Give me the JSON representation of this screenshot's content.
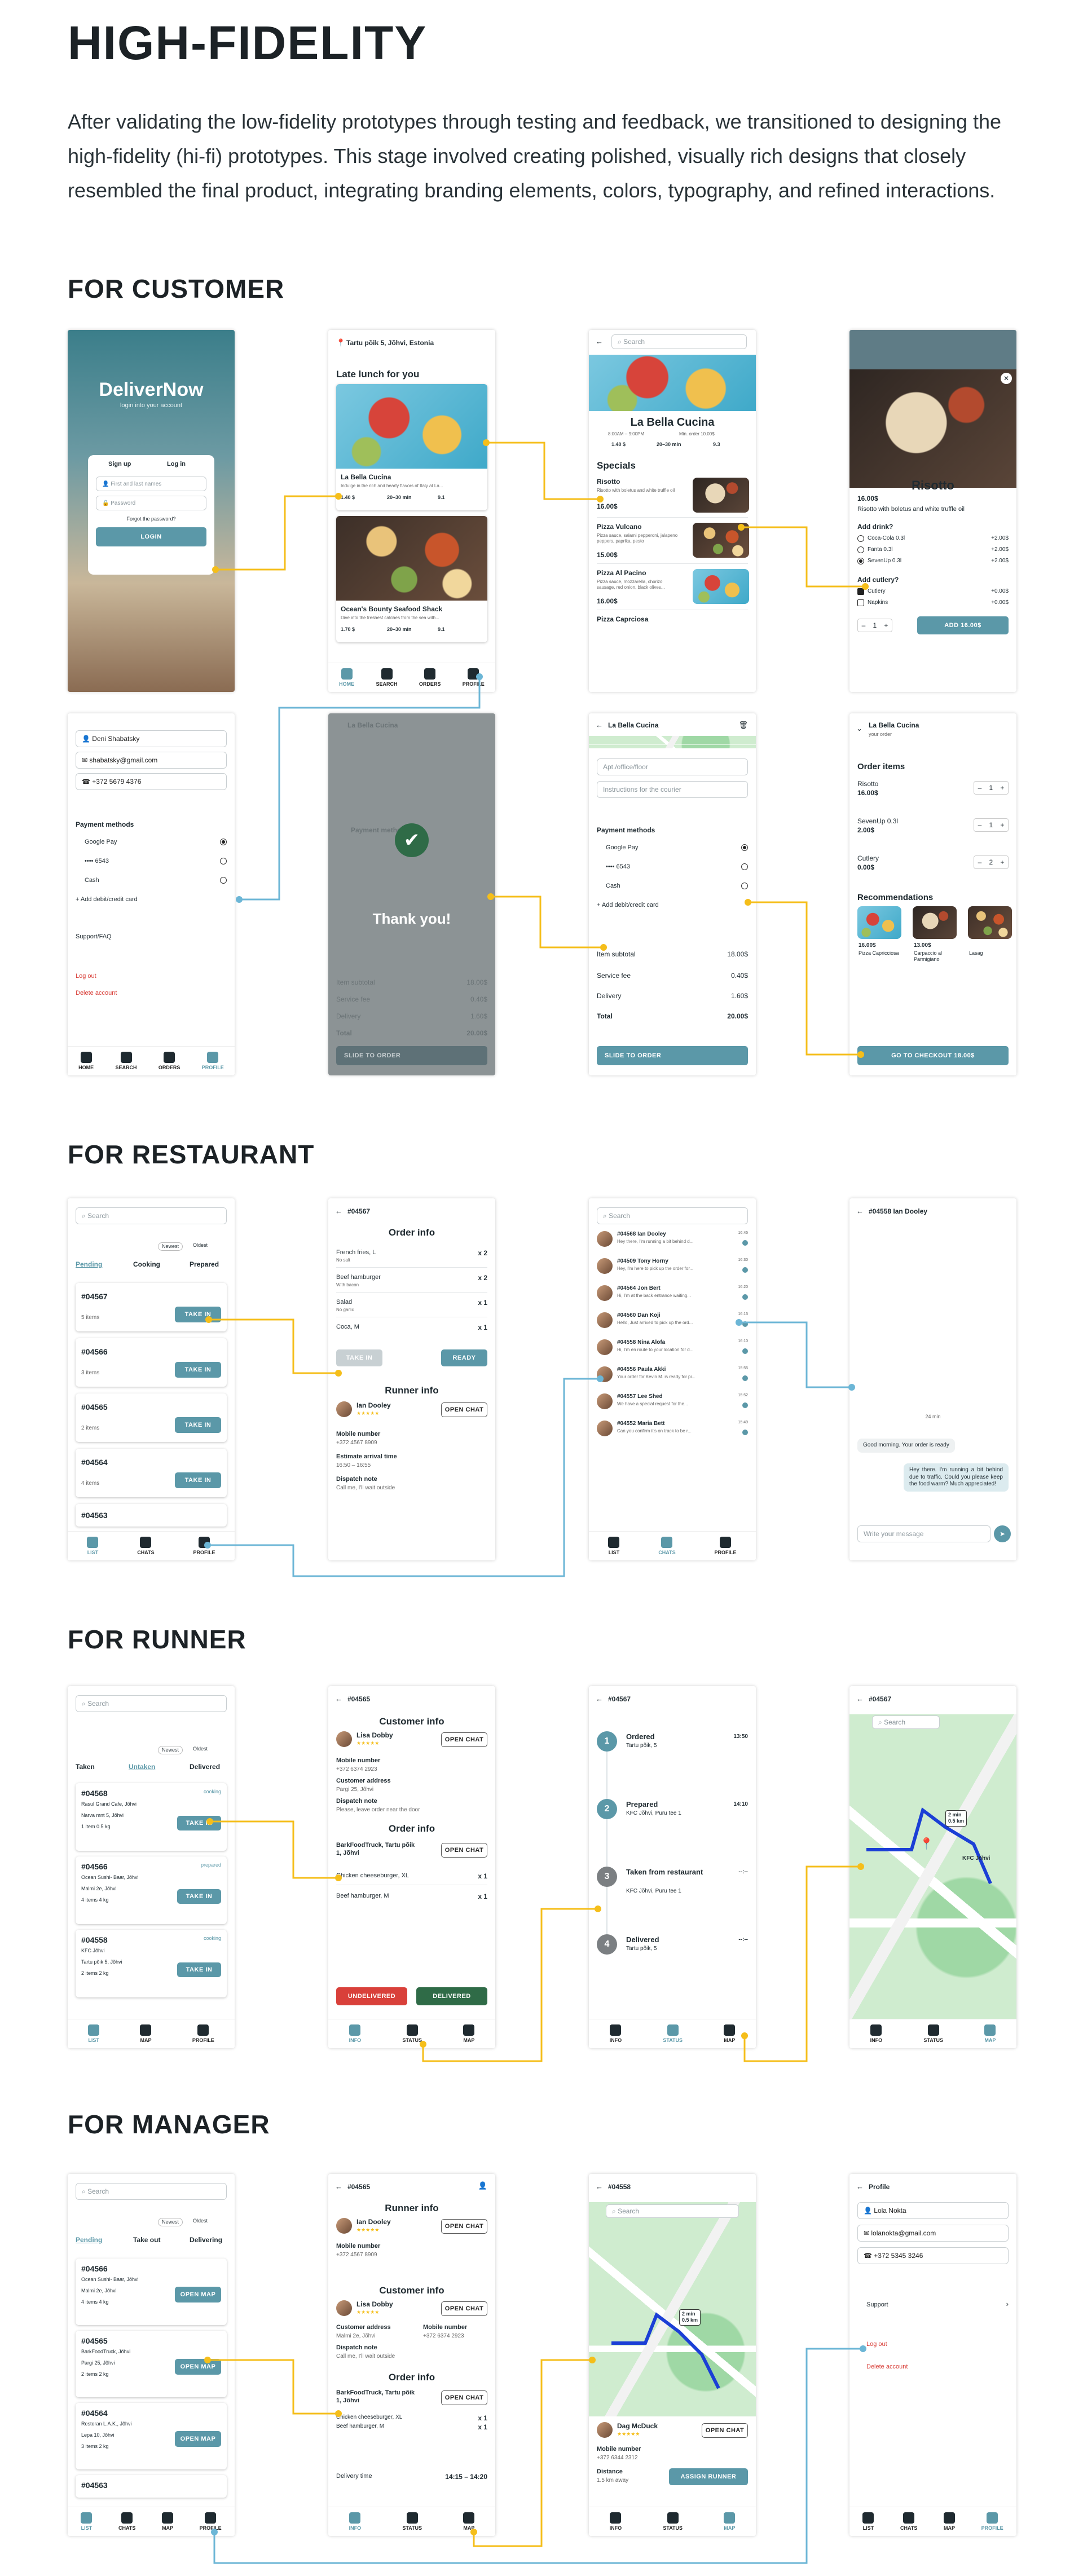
{
  "title": "HIGH-FIDELITY",
  "intro": "After validating the low-fidelity prototypes through testing and feedback, we transitioned to designing the high-fidelity (hi-fi) prototypes. This stage involved creating polished, visually rich designs that closely resembled the final product, integrating branding elements, colors, typography, and refined interactions.",
  "sections": {
    "customer": "FOR CUSTOMER",
    "restaurant": "FOR RESTAURANT",
    "runner": "FOR RUNNER",
    "manager": "FOR MANAGER"
  },
  "colors": {
    "accent": "#5b98a8",
    "connector": "#f5be1a",
    "connector_blue": "#6cb6d6",
    "danger": "#d9403a",
    "success": "#2f6b47"
  },
  "login": {
    "brand": "DeliverNow",
    "subtitle": "login into your account",
    "tab_signup": "Sign up",
    "tab_login": "Log in",
    "name_ph": "First and last names",
    "password_ph": "Password",
    "forgot": "Forgot the password?",
    "button": "LOGIN"
  },
  "home": {
    "address": "Tartu põik 5, Jõhvi, Estonia",
    "heading": "Late lunch for you",
    "r1": {
      "name": "La Bella Cucina",
      "desc": "Indulge in the rich and hearty flavors of Italy at La...",
      "price": "1.40 $",
      "time": "20–30 min",
      "rating": "9.1"
    },
    "r2": {
      "name": "Ocean's Bounty Seafood Shack",
      "desc": "Dive into the freshest catches from the sea with...",
      "price": "1.70 $",
      "time": "20–30 min",
      "rating": "9.1"
    }
  },
  "tabs": {
    "home": "HOME",
    "search": "SEARCH",
    "orders": "ORDERS",
    "profile": "PROFILE",
    "list": "LIST",
    "chats": "CHATS",
    "map": "MAP",
    "info": "INFO",
    "status": "STATUS"
  },
  "search_ph": "Search",
  "restaurant_page": {
    "name": "La Bella Cucina",
    "hours": "8:00AM – 9:00PM",
    "min_order": "Min. order 10.00$",
    "price": "1.40 $",
    "time": "20–30 min",
    "rating": "9.3",
    "specials": "Specials",
    "items": [
      {
        "name": "Risotto",
        "desc": "Risotto with boletus and white truffle oil",
        "price": "16.00$"
      },
      {
        "name": "Pizza Vulcano",
        "desc": "Pizza sauce, salami pepperoni, jalapeno peppers, paprika, pesto",
        "price": "15.00$"
      },
      {
        "name": "Pizza Al Pacino",
        "desc": "Pizza sauce, mozzarella, chorizo sausage, red onion, black olives...",
        "price": "16.00$"
      },
      {
        "name": "Pizza Caprciosa",
        "desc": "",
        "price": ""
      }
    ]
  },
  "dish": {
    "name": "Risotto",
    "price": "16.00$",
    "desc": "Risotto with boletus and white truffle oil",
    "drink_title": "Add drink?",
    "drinks": [
      {
        "name": "Coca-Cola 0.3l",
        "price": "+2.00$"
      },
      {
        "name": "Fanta 0.3l",
        "price": "+2.00$"
      },
      {
        "name": "SevenUp 0.3l",
        "price": "+2.00$"
      }
    ],
    "cutlery_title": "Add cutlery?",
    "cutlery": [
      {
        "name": "Cutlery",
        "price": "+0.00$"
      },
      {
        "name": "Napkins",
        "price": "+0.00$"
      }
    ],
    "qty": "1",
    "add_button": "ADD 16.00$"
  },
  "profile_customer": {
    "name": "Deni Shabatsky",
    "email": "shabatsky@gmail.com",
    "phone": "+372 5679 4376",
    "payment_title": "Payment methods",
    "google": "Google Pay",
    "card": "•••• 6543",
    "cash": "Cash",
    "add_card": "Add debit/credit card",
    "support": "Support/FAQ",
    "logout": "Log out",
    "delete": "Delete account"
  },
  "checkout": {
    "title": "La Bella Cucina",
    "apt_ph": "Apt./office/floor",
    "instructions_ph": "Instructions for the courier",
    "payment_title": "Payment methods",
    "google": "Google Pay",
    "card": "•••• 6543",
    "cash": "Cash",
    "add_card": "Add debit/credit card",
    "subtotal_label": "Item subtotal",
    "subtotal": "18.00$",
    "fee_label": "Service fee",
    "fee": "0.40$",
    "delivery_label": "Delivery",
    "delivery": "1.60$",
    "total_label": "Total",
    "total": "20.00$",
    "slide": "SLIDE TO ORDER",
    "thanks": "Thank you!"
  },
  "cart": {
    "title": "La Bella Cucina",
    "subtitle": "your order",
    "items_title": "Order items",
    "items": [
      {
        "name": "Risotto",
        "price": "16.00$",
        "qty": "1"
      },
      {
        "name": "SevenUp 0.3l",
        "price": "2.00$",
        "qty": "1"
      },
      {
        "name": "Cutlery",
        "price": "0.00$",
        "qty": "2"
      }
    ],
    "rec_title": "Recommendations",
    "recs": [
      {
        "price": "16.00$",
        "name": "Pizza Capricciosa"
      },
      {
        "price": "13.00$",
        "name": "Carpaccio al Parmigiano"
      },
      {
        "price": "",
        "name": "Lasag"
      }
    ],
    "button": "GO TO CHECKOUT 18.00$"
  },
  "rest_list": {
    "sort1": "Newest",
    "sort2": "Oldest",
    "tab1": "Pending",
    "tab2": "Cooking",
    "tab3": "Prepared",
    "take_in": "TAKE IN",
    "orders": [
      {
        "id": "#04567",
        "items": "5 items"
      },
      {
        "id": "#04566",
        "items": "3 items"
      },
      {
        "id": "#04565",
        "items": "2 items"
      },
      {
        "id": "#04564",
        "items": "4 items"
      },
      {
        "id": "#04563",
        "items": ""
      }
    ]
  },
  "order_info": {
    "id": "#04567",
    "title": "Order info",
    "lines": [
      {
        "name": "French fries, L",
        "note": "No salt",
        "qty": "x 2"
      },
      {
        "name": "Beef hamburger",
        "note": "With bacon",
        "qty": "x 2"
      },
      {
        "name": "Salad",
        "note": "No garlic",
        "qty": "x 1"
      },
      {
        "name": "Coca, M",
        "note": "",
        "qty": "x 1"
      }
    ],
    "take_in": "TAKE IN",
    "ready": "READY",
    "runner_title": "Runner info",
    "runner_name": "Ian Dooley",
    "open_chat": "OPEN CHAT",
    "mobile_label": "Mobile number",
    "mobile": "+372 4567 8909",
    "eta_label": "Estimate arrival time",
    "eta": "16:50 – 16:55",
    "note_label": "Dispatch note",
    "note": "Call me, I'll wait outside"
  },
  "chats": {
    "list": [
      {
        "id": "#04568 Ian Dooley",
        "msg": "Hey there, I'm running a bit behind d...",
        "time": "16:45"
      },
      {
        "id": "#04509 Tony Horny",
        "msg": "Hey, I'm here to pick up the order for...",
        "time": "16:30"
      },
      {
        "id": "#04564 Jon Bert",
        "msg": "Hi, I'm at the back entrance waiting...",
        "time": "16:20"
      },
      {
        "id": "#04560 Dan Koji",
        "msg": "Hello, Just arrived to pick up the ord...",
        "time": "16:15"
      },
      {
        "id": "#04558 Nina Alofa",
        "msg": "Hi, I'm en route to your location for d...",
        "time": "16:10"
      },
      {
        "id": "#04556 Paula Akki",
        "msg": "Your order for Kevin M. is ready for pi...",
        "time": "15:55"
      },
      {
        "id": "#04557 Lee Shed",
        "msg": "We have a special request for the...",
        "time": "15:52"
      },
      {
        "id": "#04552 Maria Bett",
        "msg": "Can you confirm it's on track to be r...",
        "time": "15:49"
      }
    ]
  },
  "chat": {
    "title": "#04558 Ian Dooley",
    "day": "24 min",
    "in_msg": "Good morning. Your order is ready",
    "out_msg": "Hey there. I'm running a bit behind due to traffic. Could you please keep the food warm? Much appreciated!",
    "input_ph": "Write your message"
  },
  "runner_list": {
    "sort1": "Newest",
    "sort2": "Oldest",
    "tab1": "Taken",
    "tab2": "Untaken",
    "tab3": "Delivered",
    "take_in": "TAKE IN",
    "orders": [
      {
        "id": "#04568",
        "status": "cooking",
        "from": "Rasul Grand Cafe, Jõhvi",
        "to": "Narva mnt 5, Jõhvi",
        "meta": "1 item    0.5 kg"
      },
      {
        "id": "#04566",
        "status": "prepared",
        "from": "Ocean Sushi- Baar, Jõhvi",
        "to": "Malmi 2e, Jõhvi",
        "meta": "4 items   4 kg"
      },
      {
        "id": "#04558",
        "status": "cooking",
        "from": "KFC Jõhvi",
        "to": "Tartu põik 5, Jõhvi",
        "meta": "2 items   2 kg"
      }
    ]
  },
  "runner_info": {
    "id": "#04565",
    "cust_title": "Customer info",
    "cust_name": "Lisa Dobby",
    "open_chat": "OPEN CHAT",
    "mobile_label": "Mobile number",
    "mobile": "+372 6374 2923",
    "addr_label": "Customer address",
    "addr": "Pargi 25, Jõhvi",
    "note_label": "Dispatch note",
    "note": "Please, leave order near the door",
    "order_title": "Order info",
    "rest": "BarkFoodTruck, Tartu põik 1, Jõhvi",
    "lines": [
      {
        "name": "Chicken cheeseburger, XL",
        "qty": "x 1"
      },
      {
        "name": "Beef hamburger, M",
        "qty": "x 1"
      }
    ],
    "undelivered": "UNDELIVERED",
    "delivered": "DELIVERED"
  },
  "status": {
    "id": "#04567",
    "steps": [
      {
        "n": "1",
        "title": "Ordered",
        "place": "Tartu põik, 5",
        "time": "13:50"
      },
      {
        "n": "2",
        "title": "Prepared",
        "place": "KFC Jõhvi, Puru tee 1",
        "time": "14:10"
      },
      {
        "n": "3",
        "title": "Taken from restaurant",
        "place": "KFC Jõhvi, Puru tee 1",
        "time": "--:--"
      },
      {
        "n": "4",
        "title": "Delivered",
        "place": "Tartu põik, 5",
        "time": "--:--"
      }
    ]
  },
  "runner_map": {
    "id": "#04567",
    "eta": "2 min",
    "dist": "0.5 km",
    "poi": "KFC Jõhvi"
  },
  "mgr_list": {
    "sort1": "Newest",
    "sort2": "Oldest",
    "tab1": "Pending",
    "tab2": "Take out",
    "tab3": "Delivering",
    "open_map": "OPEN MAP",
    "orders": [
      {
        "id": "#04566",
        "from": "Ocean Sushi- Baar, Jõhvi",
        "to": "Malmi 2e, Jõhvi",
        "meta": "4 items   4 kg"
      },
      {
        "id": "#04565",
        "from": "BarkFoodTruck, Jõhvi",
        "to": "Pargi 25, Jõhvi",
        "meta": "2 items   2 kg"
      },
      {
        "id": "#04564",
        "from": "Restoran L.A.K., Jõhvi",
        "to": "Lepa 10, Jõhvi",
        "meta": "3 items   2 kg"
      },
      {
        "id": "#04563",
        "from": "",
        "to": "",
        "meta": ""
      }
    ]
  },
  "mgr_info": {
    "id": "#04565",
    "runner_title": "Runner info",
    "runner_name": "Ian Dooley",
    "open_chat": "OPEN CHAT",
    "r_mobile_label": "Mobile number",
    "r_mobile": "+372 4567 8909",
    "cust_title": "Customer info",
    "cust_name": "Lisa Dobby",
    "addr_label": "Customer address",
    "addr": "Malmi 2e, Jõhvi",
    "c_mobile_label": "Mobile number",
    "c_mobile": "+372 6374 2923",
    "note_label": "Dispatch note",
    "note": "Call me, I'll wait outside",
    "order_title": "Order info",
    "rest": "BarkFoodTruck, Tartu põik 1, Jõhvi",
    "lines": [
      {
        "name": "Chicken cheeseburger, XL",
        "qty": "x 1"
      },
      {
        "name": "Beef hamburger, M",
        "qty": "x 1"
      }
    ],
    "time_label": "Delivery time",
    "time": "14:15 – 14:20"
  },
  "mgr_map": {
    "id": "#04558",
    "runner": "Dag McDuck",
    "open_chat": "OPEN CHAT",
    "mobile_label": "Mobile number",
    "mobile": "+372 6344 2312",
    "dist_label": "Distance",
    "dist": "1.5 km away",
    "assign": "ASSIGN RUNNER",
    "eta": "2 min",
    "eta_dist": "0.5 km"
  },
  "mgr_profile": {
    "title": "Profile",
    "name": "Lola Nokta",
    "email": "lolanokta@gmail.com",
    "phone": "+372 5345 3246",
    "support": "Support",
    "logout": "Log out",
    "delete": "Delete account"
  }
}
